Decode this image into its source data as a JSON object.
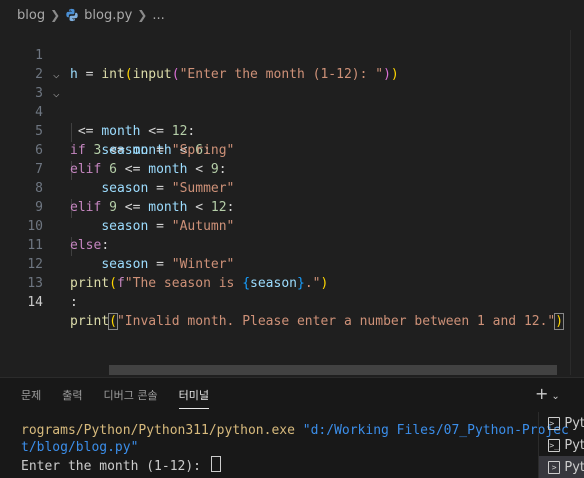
{
  "breadcrumb": {
    "folder": "blog",
    "file": "blog.py",
    "more": "..."
  },
  "editor": {
    "active_line": 14,
    "lines": [
      {
        "num": "1"
      },
      {
        "num": "2"
      },
      {
        "num": "3"
      },
      {
        "num": "4"
      },
      {
        "num": "5"
      },
      {
        "num": "6"
      },
      {
        "num": "7"
      },
      {
        "num": "8"
      },
      {
        "num": "9"
      },
      {
        "num": "10"
      },
      {
        "num": "11"
      },
      {
        "num": "12"
      },
      {
        "num": "13"
      },
      {
        "num": "14"
      }
    ],
    "code": {
      "l1": {
        "var": "h",
        "eq": " = ",
        "fn1": "int",
        "fn2": "input",
        "str": "\"Enter the month (1-12): \""
      },
      "l3": {
        "pre": " <= ",
        "var": "month",
        "op": " <= ",
        "num": "12",
        "colon": ":"
      },
      "l4": {
        "kw": "if",
        "n1": "3",
        "op1": " <= ",
        "var": "month",
        "op2": " < ",
        "n2": "6",
        "colon": ":"
      },
      "l5": {
        "var": "season",
        "eq": " = ",
        "str": "\"Spring\""
      },
      "l6": {
        "kw": "elif",
        "n1": "6",
        "op1": " <= ",
        "var": "month",
        "op2": " < ",
        "n2": "9",
        "colon": ":"
      },
      "l7": {
        "var": "season",
        "eq": " = ",
        "str": "\"Summer\""
      },
      "l8": {
        "kw": "elif",
        "n1": "9",
        "op1": " <= ",
        "var": "month",
        "op2": " < ",
        "n2": "12",
        "colon": ":"
      },
      "l9": {
        "var": "season",
        "eq": " = ",
        "str": "\"Autumn\""
      },
      "l10": {
        "kw": "else",
        "colon": ":"
      },
      "l11": {
        "var": "season",
        "eq": " = ",
        "str": "\"Winter\""
      },
      "l12": {
        "fn": "print",
        "fprefix": "f",
        "str1": "\"The season is ",
        "lb": "{",
        "var": "season",
        "rb": "}",
        "str2": ".\""
      },
      "l13": {
        "text": ":"
      },
      "l14": {
        "fn": "print",
        "str": "\"Invalid month. Please enter a number between 1 and 12.\""
      }
    }
  },
  "panel": {
    "tabs": [
      {
        "label": "문제"
      },
      {
        "label": "출력"
      },
      {
        "label": "디버그 콘솔"
      },
      {
        "label": "터미널"
      }
    ],
    "active_tab": "터미널",
    "add_label": "+",
    "chevron": "⌄",
    "terminal": {
      "line1_path": "rograms/Python/Python311/python.exe ",
      "line1_arg": "\"d:/Working Files/07_Python-Projec",
      "line2_arg": "t/blog/blog.py\"",
      "prompt": "Enter the month (1-12): "
    },
    "terminal_list": [
      {
        "label": "Pyt"
      },
      {
        "label": "Pyt"
      },
      {
        "label": "Pyt"
      }
    ]
  },
  "colors": {
    "background": "#1f1f1f",
    "keyword": "#c586c0",
    "function": "#dcdcaa",
    "variable": "#9cdcfe",
    "string": "#ce9178",
    "number": "#b5cea8"
  }
}
